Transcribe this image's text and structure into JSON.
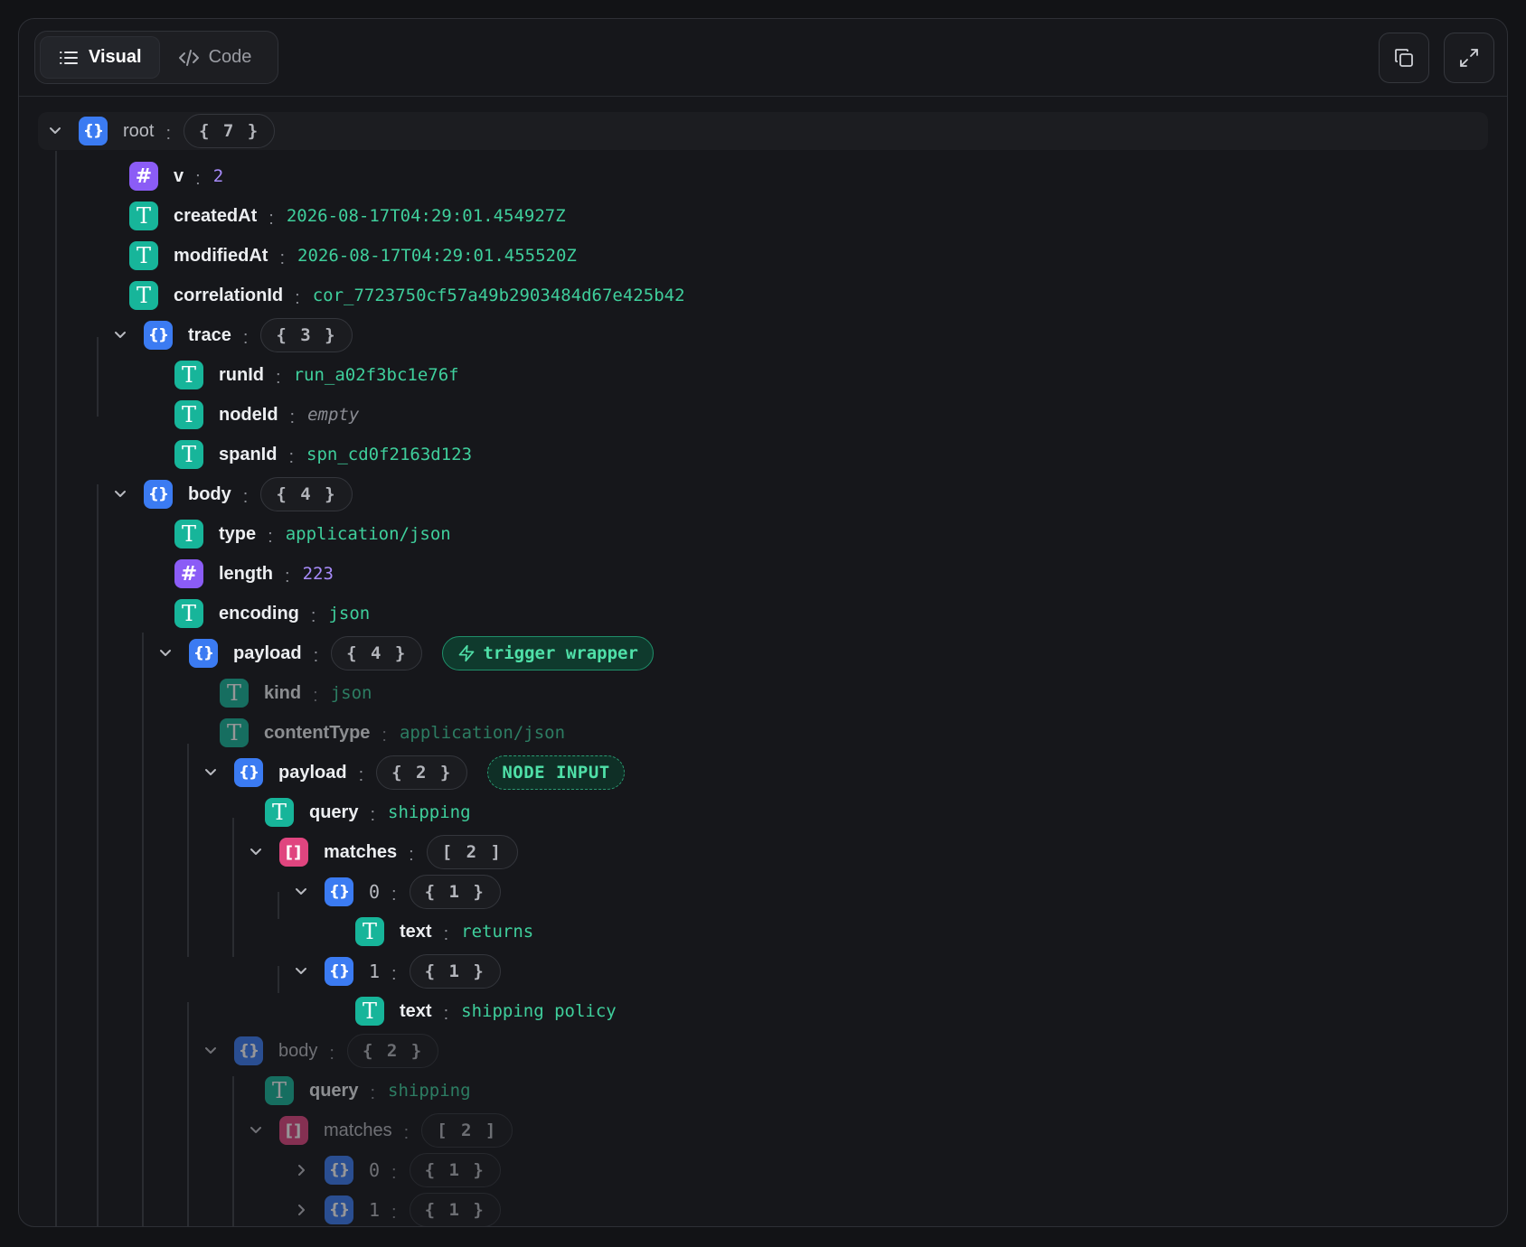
{
  "toolbar": {
    "tabs": [
      {
        "label": "Visual",
        "icon": "list-icon",
        "active": true
      },
      {
        "label": "Code",
        "icon": "code-icon",
        "active": false
      }
    ],
    "actions": [
      {
        "icon": "copy-icon"
      },
      {
        "icon": "expand-icon"
      }
    ]
  },
  "colors": {
    "object_icon": "#3b7bf2",
    "string_icon": "#17b59a",
    "number_icon": "#8b5cf6",
    "array_icon": "#e0457f",
    "string_value": "#3fcf9c",
    "number_value": "#a78bfa"
  },
  "tree": {
    "root": {
      "key": "root",
      "count": "{ 7 }"
    },
    "v": {
      "key": "v",
      "value": "2"
    },
    "createdAt": {
      "key": "createdAt",
      "value": "2026-08-17T04:29:01.454927Z"
    },
    "modifiedAt": {
      "key": "modifiedAt",
      "value": "2026-08-17T04:29:01.455520Z"
    },
    "correlationId": {
      "key": "correlationId",
      "value": "cor_7723750cf57a49b2903484d67e425b42"
    },
    "trace": {
      "key": "trace",
      "count": "{ 3 }"
    },
    "runId": {
      "key": "runId",
      "value": "run_a02f3bc1e76f"
    },
    "nodeId": {
      "key": "nodeId",
      "value": "empty"
    },
    "spanId": {
      "key": "spanId",
      "value": "spn_cd0f2163d123"
    },
    "body": {
      "key": "body",
      "count": "{ 4 }"
    },
    "type": {
      "key": "type",
      "value": "application/json"
    },
    "length": {
      "key": "length",
      "value": "223"
    },
    "encoding": {
      "key": "encoding",
      "value": "json"
    },
    "payload": {
      "key": "payload",
      "count": "{ 4 }",
      "badge": "trigger wrapper"
    },
    "kind": {
      "key": "kind",
      "value": "json"
    },
    "contentType": {
      "key": "contentType",
      "value": "application/json"
    },
    "payload2": {
      "key": "payload",
      "count": "{ 2 }",
      "badge": "NODE INPUT"
    },
    "query": {
      "key": "query",
      "value": "shipping"
    },
    "matches": {
      "key": "matches",
      "count": "[ 2 ]"
    },
    "m0": {
      "key": "0",
      "count": "{ 1 }"
    },
    "m0text": {
      "key": "text",
      "value": "returns"
    },
    "m1": {
      "key": "1",
      "count": "{ 1 }"
    },
    "m1text": {
      "key": "text",
      "value": "shipping policy"
    },
    "body2": {
      "key": "body",
      "count": "{ 2 }"
    },
    "query2": {
      "key": "query",
      "value": "shipping"
    },
    "matches2": {
      "key": "matches",
      "count": "[ 2 ]"
    },
    "m2_0": {
      "key": "0",
      "count": "{ 1 }"
    },
    "m2_1": {
      "key": "1",
      "count": "{ 1 }"
    }
  }
}
